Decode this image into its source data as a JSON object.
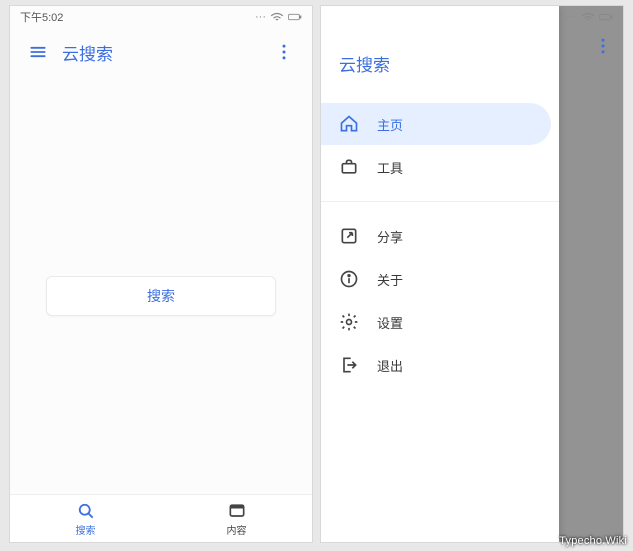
{
  "status": {
    "time": "下午5:02"
  },
  "appbar": {
    "title": "云搜索"
  },
  "main": {
    "search_button": "搜索"
  },
  "bottom_nav": [
    {
      "label": "搜索",
      "active": true
    },
    {
      "label": "内容",
      "active": false
    }
  ],
  "drawer": {
    "title": "云搜索",
    "items": [
      {
        "label": "主页",
        "icon": "home-icon",
        "active": true
      },
      {
        "label": "工具",
        "icon": "toolbox-icon",
        "active": false
      }
    ],
    "items2": [
      {
        "label": "分享",
        "icon": "share-icon",
        "active": false
      },
      {
        "label": "关于",
        "icon": "info-icon",
        "active": false
      },
      {
        "label": "设置",
        "icon": "gear-icon",
        "active": false
      },
      {
        "label": "退出",
        "icon": "exit-icon",
        "active": false
      }
    ]
  },
  "watermark": "Typecho.Wiki"
}
